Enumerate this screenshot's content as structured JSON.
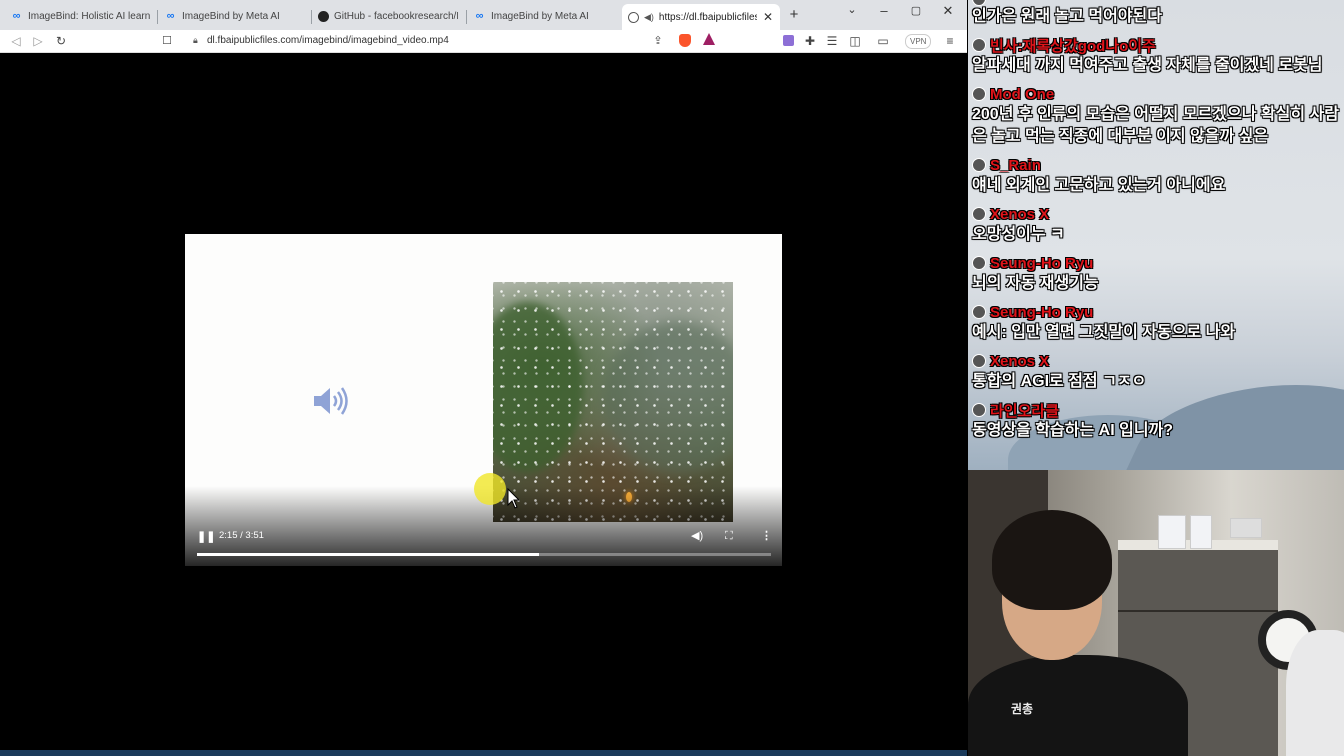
{
  "browser": {
    "tabs": [
      {
        "title": "ImageBind: Holistic AI learning ac",
        "icon": "meta-icon"
      },
      {
        "title": "ImageBind by Meta AI",
        "icon": "meta-icon"
      },
      {
        "title": "GitHub - facebookresearch/Imag",
        "icon": "github-icon"
      },
      {
        "title": "ImageBind by Meta AI",
        "icon": "meta-icon"
      },
      {
        "title": "https://dl.fbaipublicfiles.com",
        "icon": "globe-icon",
        "active": true,
        "audio": true
      }
    ],
    "new_tab": "+",
    "address_url": "dl.fbaipublicfiles.com/imagebind/imagebind_video.mp4",
    "vpn_label": "VPN",
    "colors": {
      "tabbar": "#dfe1e5",
      "brave": "#fb542b"
    }
  },
  "video": {
    "time_label": "2:15 / 3:51",
    "progress": 0.595,
    "playing": true
  },
  "chat": [
    {
      "user": "",
      "text": "인가은 원래 놀고 먹어야된다"
    },
    {
      "user": "빈사:재록상갔god나o이주",
      "text": "알파세대 까지 먹여주고 출생 자체를 줄이겠네 로봇님"
    },
    {
      "user": "Mod One",
      "text": "200년 후 인류의 모습은 어떨지 모르겠으나 확실히 사람은 놀고 먹는 직종에 대부분 이지 않을까 싶은"
    },
    {
      "user": "S_Rain",
      "text": "얘네 외계인 고문하고 있는거 아니에요"
    },
    {
      "user": "Xenos X",
      "text": "오망성이누 ㅋ"
    },
    {
      "user": "Seung-Ho Ryu",
      "text": "뇌의 자동 재생기능"
    },
    {
      "user": "Seung-Ho Ryu",
      "text": "예시: 입만 열면 그짓말이 자동으로 나와"
    },
    {
      "user": "Xenos X",
      "text": "통합의 AGI로 점점 ㄱㅈㅇ"
    },
    {
      "user": "라인오라클",
      "text": "동영상을 학습하는 AI 입니까?"
    }
  ],
  "webcam": {
    "shirt_text": "권총"
  }
}
